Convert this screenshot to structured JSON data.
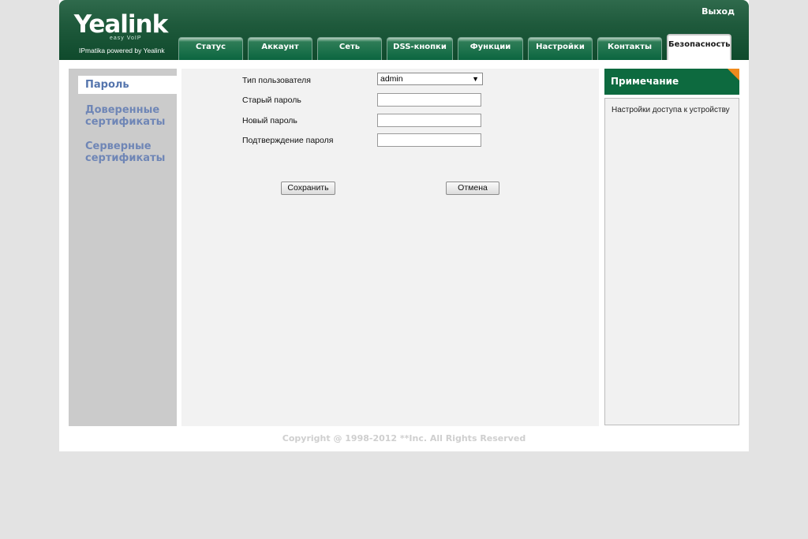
{
  "header": {
    "logo_text": "Yealink",
    "logo_sub": "easy VoIP",
    "logo_tagline": "IPmatika powered by Yealink",
    "logout_label": "Выход"
  },
  "tabs": [
    {
      "label": "Статус"
    },
    {
      "label": "Аккаунт"
    },
    {
      "label": "Сеть"
    },
    {
      "label": "DSS-кнопки"
    },
    {
      "label": "Функции"
    },
    {
      "label": "Настройки"
    },
    {
      "label": "Контакты"
    },
    {
      "label": "Безопасность",
      "active": true
    }
  ],
  "sidebar": {
    "items": [
      {
        "label": "Пароль",
        "active": true
      },
      {
        "label": "Доверенные сертификаты"
      },
      {
        "label": "Серверные сертификаты"
      }
    ]
  },
  "form": {
    "user_type_label": "Тип пользователя",
    "user_type_value": "admin",
    "old_password_label": "Старый пароль",
    "new_password_label": "Новый пароль",
    "confirm_password_label": "Подтверждение пароля",
    "save_label": "Сохранить",
    "cancel_label": "Отмена"
  },
  "note": {
    "title": "Примечание",
    "text": "Настройки доступа к устройству"
  },
  "footer": {
    "copyright": "Copyright @ 1998-2012 **Inc. All Rights Reserved"
  },
  "colors": {
    "header_green": "#0f4a2c",
    "tab_green": "#0b6540",
    "note_green": "#0d6a3f",
    "note_corner": "#f08a1c",
    "nav_link": "#6f86b6"
  }
}
